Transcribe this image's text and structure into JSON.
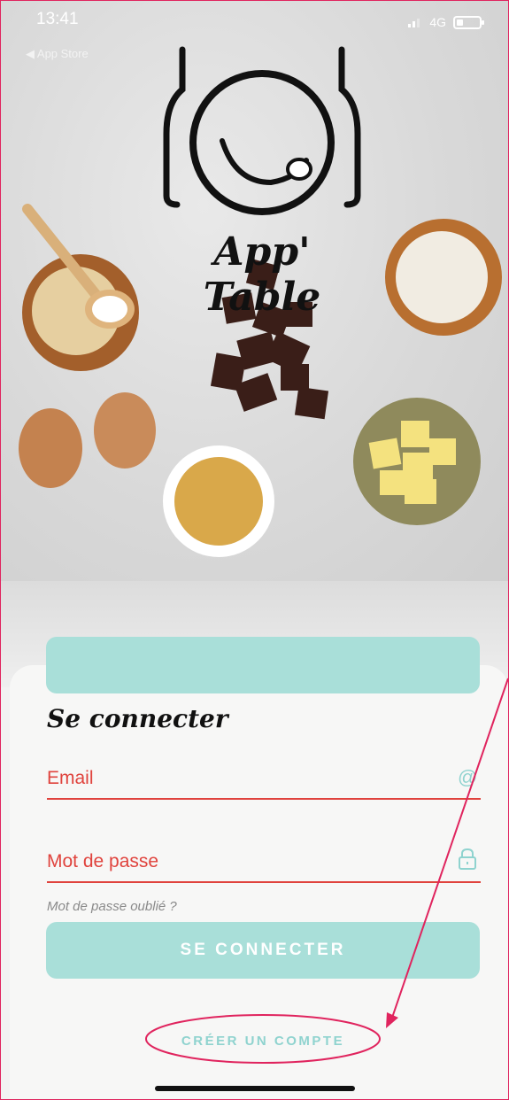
{
  "status_bar": {
    "time": "13:41",
    "back_label": "◀ App Store",
    "network": "4G"
  },
  "brand": {
    "name": "App' Table"
  },
  "login": {
    "title": "Se connecter",
    "email_label": "Email",
    "email_icon": "@",
    "password_label": "Mot de passe",
    "forgot_label": "Mot de passe oublié ?",
    "submit_label": "SE CONNECTER",
    "create_account_label": "CRÉER UN COMPTE"
  },
  "colors": {
    "accent_red": "#e0433d",
    "accent_teal": "#8fd3cf",
    "button_teal": "#a9dfd9",
    "annotation_pink": "#e0245e"
  }
}
